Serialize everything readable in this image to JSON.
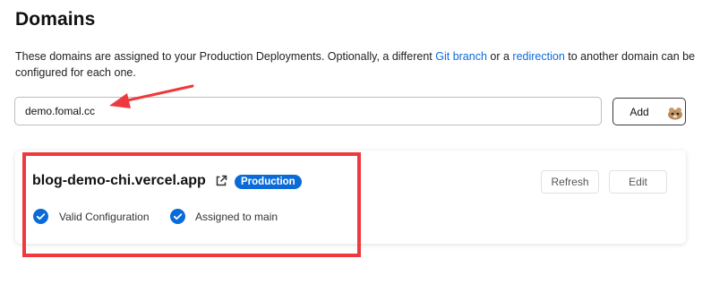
{
  "section": {
    "title": "Domains",
    "description": {
      "part1": "These domains are assigned to your Production Deployments. Optionally, a different ",
      "link1": "Git branch",
      "part2": " or a ",
      "link2": "redirection",
      "part3": " to another domain can be configured for each one."
    }
  },
  "form": {
    "input_value": "demo.fomal.cc",
    "add_label": "Add"
  },
  "domain_card": {
    "domain": "blog-demo-chi.vercel.app",
    "badge": "Production",
    "refresh_label": "Refresh",
    "edit_label": "Edit",
    "checks": [
      {
        "label": "Valid Configuration"
      },
      {
        "label": "Assigned to main"
      }
    ]
  },
  "colors": {
    "accent": "#0a6bd8",
    "annotation": "#ee3a3e"
  },
  "icons": {
    "external": "external-link-icon",
    "check": "check-circle-icon",
    "mascot": "mascot-icon"
  }
}
